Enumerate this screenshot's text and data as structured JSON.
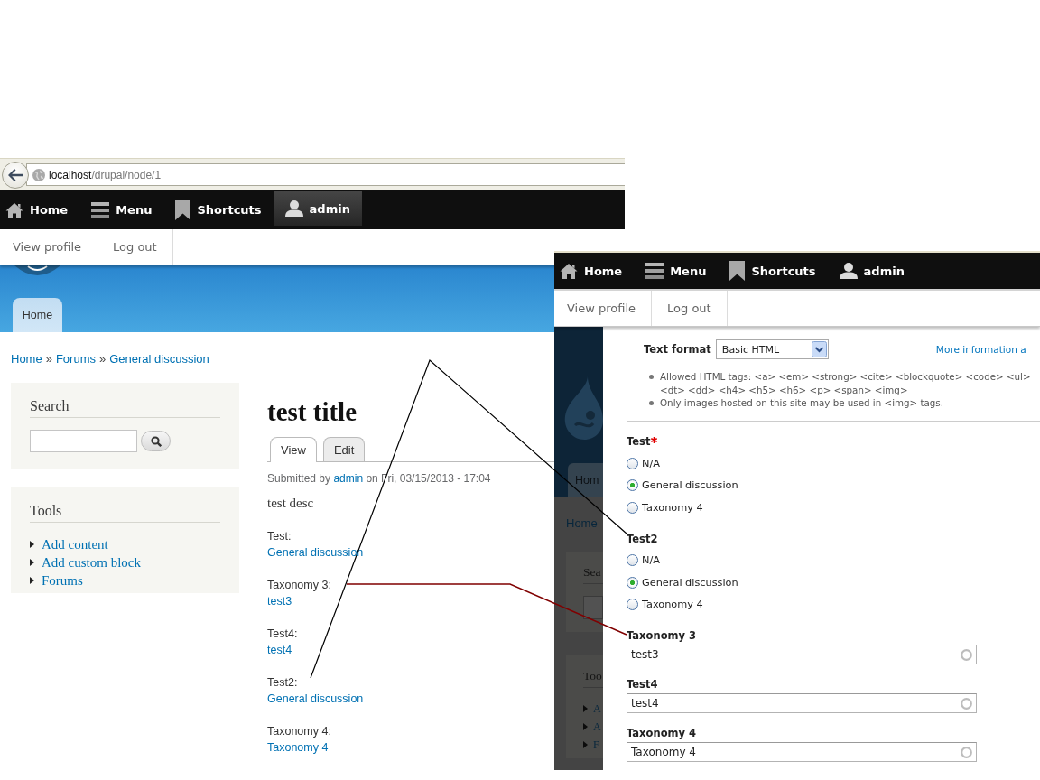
{
  "browser_window": {
    "address_bar": {
      "host": "localhost",
      "path": "/drupal/node/1"
    },
    "toolbar": [
      {
        "kind": "home",
        "label": "Home",
        "selected": false
      },
      {
        "kind": "menu",
        "label": "Menu",
        "selected": false
      },
      {
        "kind": "shortcuts",
        "label": "Shortcuts",
        "selected": false
      },
      {
        "kind": "user",
        "label": "admin",
        "selected": true
      }
    ],
    "tray": [
      "View profile",
      "Log out"
    ],
    "header": {
      "tab": "Home"
    },
    "breadcrumb": [
      {
        "kind": "link",
        "text": "Home"
      },
      {
        "kind": "separator",
        "text": "»"
      },
      {
        "kind": "link",
        "text": "Forums"
      },
      {
        "kind": "separator",
        "text": "»"
      },
      {
        "kind": "link",
        "text": "General discussion"
      }
    ],
    "sidebar": {
      "search": {
        "title": "Search"
      },
      "tools": {
        "title": "Tools",
        "items": [
          "Add content",
          "Add custom block",
          "Forums"
        ]
      }
    },
    "node": {
      "title": "test title",
      "tabs": [
        {
          "label": "View",
          "selected": true
        },
        {
          "label": "Edit",
          "selected": false
        }
      ],
      "submitted": {
        "before": "Submitted by",
        "author": "admin",
        "after": "on Fri, 03/15/2013 - 17:04"
      },
      "body": "test desc",
      "fields": [
        {
          "label": "Test:",
          "value": "General discussion"
        },
        {
          "label": "Taxonomy 3:",
          "value": "test3"
        },
        {
          "label": "Test4:",
          "value": "test4"
        },
        {
          "label": "Test2:",
          "value": "General discussion"
        },
        {
          "label": "Taxonomy 4:",
          "value": "Taxonomy 4"
        }
      ]
    }
  },
  "edit_window": {
    "toolbar": [
      {
        "kind": "home",
        "label": "Home",
        "selected": false
      },
      {
        "kind": "menu",
        "label": "Menu",
        "selected": false
      },
      {
        "kind": "shortcuts",
        "label": "Shortcuts",
        "selected": false
      },
      {
        "kind": "user",
        "label": "admin",
        "selected": false
      }
    ],
    "tray": [
      "View profile",
      "Log out"
    ],
    "background_page": {
      "tab": "Hom",
      "breadcrumb": "Home",
      "search_title": "Sea",
      "tools_title": "Too",
      "tools_items": [
        "A",
        "A",
        "F"
      ]
    },
    "text_format": {
      "label": "Text format",
      "selected": "Basic HTML",
      "link": "More information a",
      "tips": [
        {
          "lines": [
            "Allowed HTML tags: <a> <em> <strong> <cite> <blockquote> <code> <ul>",
            "<dt> <dd> <h4> <h5> <h6> <p> <span> <img>"
          ]
        },
        {
          "lines": [
            "Only images hosted on this site may be used in <img> tags."
          ]
        }
      ]
    },
    "fields": [
      {
        "kind": "radios",
        "label": "Test",
        "required": true,
        "options": [
          {
            "label": "N/A",
            "selected": false
          },
          {
            "label": "General discussion",
            "selected": true
          },
          {
            "label": "Taxonomy 4",
            "selected": false
          }
        ]
      },
      {
        "kind": "radios",
        "label": "Test2",
        "required": false,
        "options": [
          {
            "label": "N/A",
            "selected": false
          },
          {
            "label": "General discussion",
            "selected": true
          },
          {
            "label": "Taxonomy 4",
            "selected": false
          }
        ]
      },
      {
        "kind": "autocomplete",
        "label": "Taxonomy 3",
        "required": false,
        "value": "test3"
      },
      {
        "kind": "autocomplete",
        "label": "Test4",
        "required": false,
        "value": "test4"
      },
      {
        "kind": "autocomplete",
        "label": "Taxonomy 4",
        "required": false,
        "value": "Taxonomy 4"
      }
    ]
  }
}
